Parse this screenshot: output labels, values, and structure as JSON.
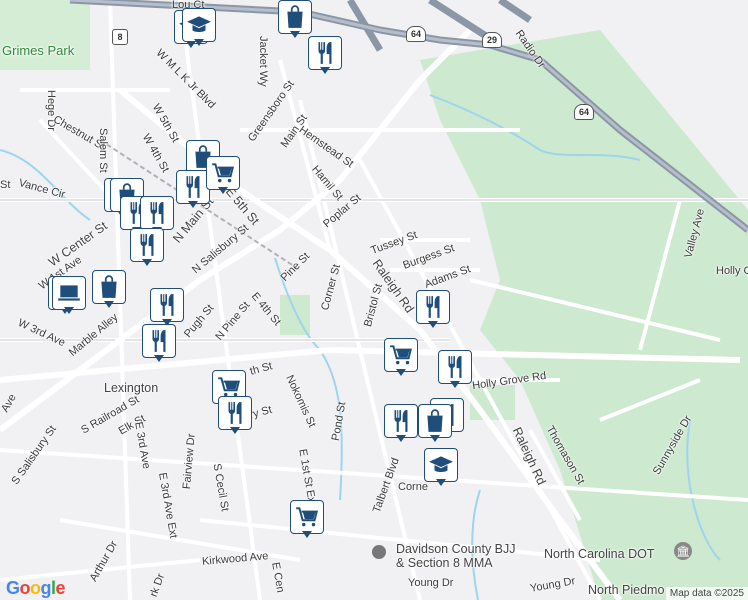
{
  "labels": {
    "grimes_park": "Grimes Park",
    "hege_dr": "Hege Dr",
    "chestnut_st": "Chestnut St",
    "salem_st": "Salem St",
    "w_4th_st": "W 4th St",
    "w_5th_st": "W 5th St",
    "w_mlk_jr_blvd": "W M L K Jr Blvd",
    "jacket_way": "Jacket Wy",
    "greensboro_st": "Greensboro St",
    "main_st": "Main St",
    "hemstead_st": "Hemstead St",
    "hamil_st": "Hamil St",
    "poplar_st": "Poplar St",
    "vance_cir": "Vance Cir",
    "w_center_st": "W Center St",
    "w_1st_ave": "W 1st Ave",
    "w_3rd_ave": "W 3rd Ave",
    "n_main_st": "N Main St",
    "e_5th_st": "E 5th St",
    "n_salisbury_st": "N Salisbury St",
    "tussey_st": "Tussey St",
    "burgess_st": "Burgess St",
    "adams_st": "Adams St",
    "raleigh_rd_top": "Raleigh Rd",
    "raleigh_rd_bottom": "Raleigh Rd",
    "bristol_st": "Bristol St",
    "corner_st": "Corner St",
    "pine_st": "Pine St",
    "e_4th_st": "E 4th St",
    "n_pine_st": "N Pine St",
    "pugh_st": "Pugh St",
    "marble_alley": "Marble Alley",
    "lexington": "Lexington",
    "s_railroad_st": "S Railroad St",
    "elk_st": "Elk St",
    "e_3rd_ave": "E 3rd Ave",
    "e_3rd_ave_ext": "E 3rd Ave Ext",
    "fairview_dr": "Fairview Dr",
    "s_cecil_st": "S Cecil St",
    "nokomis_st": "Nokomis St",
    "pond_st": "Pond St",
    "e_1st_st_ext": "E 1st St Ext",
    "talbert_blvd": "Talbert Blvd",
    "holly_grove_rd": "Holly Grove Rd",
    "thomason_st": "Thomason St",
    "sunnyside_dr": "Sunnyside Dr",
    "valley_ave": "Valley Ave",
    "holly_right": "Holly G",
    "radio_dr": "Radio Dr",
    "s_salisbury_st": "S Salisbury St",
    "kirkwood_ave": "Kirkwood Ave",
    "young_dr": "Young Dr",
    "young_dr_2": "Young Dr",
    "arthur_dr": "Arthur Dr",
    "e_center_st": "E Cen",
    "lou_ct": "Lou Ct",
    "corner_bottom": "Corne",
    "ave_left": "Ave",
    "st_left": "St",
    "bj_place": "Davidson County BJJ\n& Section 8 MMA",
    "nc_dot": "North Carolina DOT",
    "north_piedmont": "North Piedmo",
    "ry_st": "rry St",
    "th_st": "th St",
    "york_dr": "rk Dr"
  },
  "shields": {
    "nc8": "8",
    "us64_a": "64",
    "us64_b": "64",
    "us29": "29"
  },
  "pois": [
    {
      "type": "school-icon"
    },
    {
      "type": "restaurant-icon"
    },
    {
      "type": "shopping-icon"
    },
    {
      "type": "grocery-icon"
    },
    {
      "type": "shopping-icon"
    },
    {
      "type": "restaurant-icon"
    },
    {
      "type": "grocery-icon"
    },
    {
      "type": "shopping-icon"
    },
    {
      "type": "restaurant-icon"
    },
    {
      "type": "restaurant-icon"
    },
    {
      "type": "restaurant-icon"
    },
    {
      "type": "shopping-icon"
    },
    {
      "type": "shopping-icon"
    },
    {
      "type": "restaurant-icon"
    },
    {
      "type": "restaurant-icon"
    },
    {
      "type": "restaurant-icon"
    },
    {
      "type": "grocery-icon"
    },
    {
      "type": "grocery-icon"
    },
    {
      "type": "restaurant-icon"
    },
    {
      "type": "restaurant-icon"
    },
    {
      "type": "restaurant-icon"
    },
    {
      "type": "shopping-icon"
    },
    {
      "type": "restaurant-icon"
    },
    {
      "type": "school-icon"
    },
    {
      "type": "grocery-icon"
    },
    {
      "type": "school-icon"
    },
    {
      "type": "laptop-icon"
    }
  ],
  "google_logo": "Google",
  "attribution": "Map data ©2025",
  "colors": {
    "poi_border": "#1f4e7a",
    "park": "#cde9cf",
    "highway": "#8b97a6",
    "water": "#9ed4ee"
  }
}
